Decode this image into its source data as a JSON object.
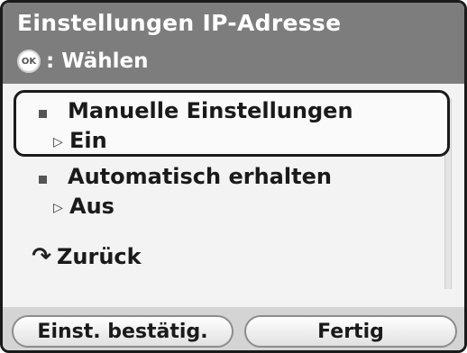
{
  "header": {
    "title": "Einstellungen IP-Adresse",
    "ok_icon_label": "OK",
    "ok_separator": ":",
    "hint": "Wählen"
  },
  "list": {
    "items": [
      {
        "label": "Manuelle Einstellungen",
        "value": "Ein",
        "selected": true
      },
      {
        "label": "Automatisch erhalten",
        "value": "Aus",
        "selected": false
      }
    ],
    "back_label": "Zurück"
  },
  "footer": {
    "confirm_label": "Einst. bestätig.",
    "done_label": "Fertig"
  },
  "icons": {
    "ok": "ok-button-icon",
    "bullet": "square-bullet-icon",
    "value": "triangle-right-icon",
    "back": "return-arrow-icon"
  },
  "colors": {
    "header_bg": "#7d7d7d",
    "list_bg": "#f3f3f3",
    "footer_bg": "#d4d4d4",
    "text": "#1a1a1a"
  }
}
